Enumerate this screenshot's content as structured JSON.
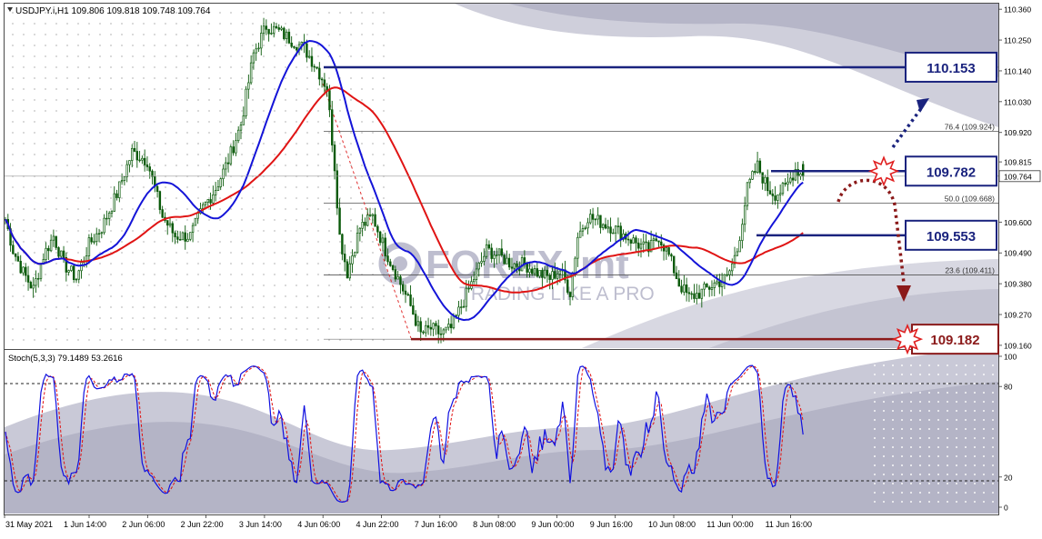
{
  "header": {
    "symbol_line": "USDJPY.i,H1  109.806 109.818 109.748 109.764"
  },
  "watermark": {
    "brand": "FOREX.",
    "brand_suffix": "mt",
    "tagline": "TRADING LIKE A PRO"
  },
  "price_axis": {
    "ticks": [
      "110.360",
      "110.250",
      "110.140",
      "110.030",
      "109.920",
      "109.815",
      "109.764",
      "109.600",
      "109.490",
      "109.380",
      "109.270",
      "109.160"
    ]
  },
  "stoch_axis": {
    "ticks": [
      "100",
      "80",
      "20",
      "0"
    ]
  },
  "time_axis": {
    "labels": [
      "31 May 2021",
      "1 Jun 14:00",
      "2 Jun 06:00",
      "2 Jun 22:00",
      "3 Jun 14:00",
      "4 Jun 06:00",
      "4 Jun 22:00",
      "7 Jun 16:00",
      "8 Jun 08:00",
      "9 Jun 00:00",
      "9 Jun 16:00",
      "10 Jun 08:00",
      "11 Jun 00:00",
      "11 Jun 16:00"
    ]
  },
  "levels": [
    {
      "label": "110.153",
      "price": 110.153,
      "color": "#1a237e",
      "marker": "none"
    },
    {
      "label": "109.782",
      "price": 109.782,
      "color": "#1a237e",
      "marker": "burst"
    },
    {
      "label": "109.553",
      "price": 109.553,
      "color": "#1a237e",
      "marker": "none"
    },
    {
      "label": "109.182",
      "price": 109.182,
      "color": "#8b1a1a",
      "marker": "burst"
    }
  ],
  "fibo": [
    {
      "label": "76.4 (109.924)",
      "price": 109.924
    },
    {
      "label": "50.0 (109.668)",
      "price": 109.668
    },
    {
      "label": "23.6 (109.411)",
      "price": 109.411
    }
  ],
  "stoch": {
    "label": "Stoch(5,3,3) 79.1489 53.2616",
    "main_color": "#1010e0",
    "signal_color": "#e01010"
  },
  "colors": {
    "candle": "#0a5a0a",
    "ma_fast": "#1414d8",
    "ma_slow": "#e01414",
    "arrow_up": "#1a237e",
    "arrow_down": "#8b1a1a"
  },
  "chart_data": {
    "type": "candlestick",
    "symbol": "USDJPY.i",
    "timeframe": "H1",
    "ylim": [
      109.15,
      110.38
    ],
    "last_price": 109.764,
    "ohlc_last": {
      "open": 109.806,
      "high": 109.818,
      "low": 109.748,
      "close": 109.764
    },
    "close_path": [
      [
        0,
        109.61
      ],
      [
        3,
        109.5
      ],
      [
        7,
        109.42
      ],
      [
        11,
        109.36
      ],
      [
        15,
        109.48
      ],
      [
        19,
        109.55
      ],
      [
        23,
        109.45
      ],
      [
        28,
        109.4
      ],
      [
        33,
        109.52
      ],
      [
        38,
        109.58
      ],
      [
        44,
        109.7
      ],
      [
        50,
        109.85
      ],
      [
        56,
        109.82
      ],
      [
        62,
        109.62
      ],
      [
        67,
        109.55
      ],
      [
        73,
        109.55
      ],
      [
        78,
        109.65
      ],
      [
        83,
        109.72
      ],
      [
        88,
        109.82
      ],
      [
        93,
        109.95
      ],
      [
        98,
        110.2
      ],
      [
        103,
        110.3
      ],
      [
        108,
        110.28
      ],
      [
        113,
        110.25
      ],
      [
        118,
        110.22
      ],
      [
        123,
        110.15
      ],
      [
        127,
        110.08
      ],
      [
        130,
        109.8
      ],
      [
        132,
        109.55
      ],
      [
        135,
        109.42
      ],
      [
        140,
        109.58
      ],
      [
        145,
        109.62
      ],
      [
        150,
        109.5
      ],
      [
        155,
        109.4
      ],
      [
        160,
        109.3
      ],
      [
        164,
        109.2
      ],
      [
        168,
        109.22
      ],
      [
        172,
        109.2
      ],
      [
        176,
        109.22
      ],
      [
        180,
        109.3
      ],
      [
        185,
        109.4
      ],
      [
        190,
        109.5
      ],
      [
        195,
        109.48
      ],
      [
        200,
        109.45
      ],
      [
        205,
        109.45
      ],
      [
        210,
        109.42
      ],
      [
        215,
        109.4
      ],
      [
        219,
        109.43
      ],
      [
        223,
        109.35
      ],
      [
        226,
        109.55
      ],
      [
        230,
        109.62
      ],
      [
        235,
        109.6
      ],
      [
        240,
        109.58
      ],
      [
        245,
        109.55
      ],
      [
        250,
        109.52
      ],
      [
        254,
        109.5
      ],
      [
        258,
        109.55
      ],
      [
        262,
        109.48
      ],
      [
        266,
        109.38
      ],
      [
        270,
        109.33
      ],
      [
        275,
        109.35
      ],
      [
        280,
        109.38
      ],
      [
        285,
        109.4
      ],
      [
        289,
        109.5
      ],
      [
        293,
        109.72
      ],
      [
        297,
        109.8
      ],
      [
        301,
        109.72
      ],
      [
        304,
        109.7
      ],
      [
        308,
        109.72
      ],
      [
        312,
        109.79
      ],
      [
        315,
        109.764
      ]
    ]
  }
}
